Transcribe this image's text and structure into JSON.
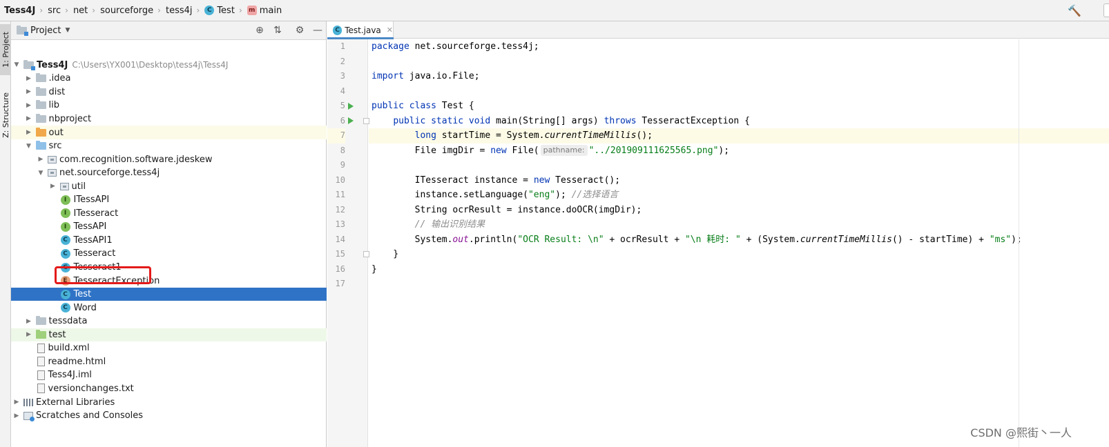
{
  "breadcrumb": [
    {
      "label": "Tess4J",
      "icon": "project-icon"
    },
    {
      "label": "src",
      "icon": "folder-icon"
    },
    {
      "label": "net",
      "icon": "package-icon"
    },
    {
      "label": "sourceforge",
      "icon": "package-icon"
    },
    {
      "label": "tess4j",
      "icon": "package-icon"
    },
    {
      "label": "Test",
      "icon": "class-icon",
      "badge": "C"
    },
    {
      "label": "main",
      "icon": "method-icon",
      "badge": "m"
    }
  ],
  "toolwindow_tabs": {
    "project": "1: Project",
    "structure": "Z: Structure"
  },
  "project_panel": {
    "title": "Project",
    "root": {
      "name": "Tess4J",
      "path": "C:\\Users\\YX001\\Desktop\\tess4j\\Tess4J"
    },
    "items": [
      {
        "label": ".idea",
        "depth": 1,
        "icon": "folder",
        "expanded": false
      },
      {
        "label": "dist",
        "depth": 1,
        "icon": "folder",
        "expanded": false
      },
      {
        "label": "lib",
        "depth": 1,
        "icon": "folder",
        "expanded": false
      },
      {
        "label": "nbproject",
        "depth": 1,
        "icon": "folder",
        "expanded": false
      },
      {
        "label": "out",
        "depth": 1,
        "icon": "folder-orange",
        "expanded": false,
        "highlight": "out"
      },
      {
        "label": "src",
        "depth": 1,
        "icon": "folder-blue",
        "expanded": true
      },
      {
        "label": "com.recognition.software.jdeskew",
        "depth": 2,
        "icon": "package",
        "expanded": false
      },
      {
        "label": "net.sourceforge.tess4j",
        "depth": 2,
        "icon": "package",
        "expanded": true
      },
      {
        "label": "util",
        "depth": 3,
        "icon": "package",
        "expanded": false
      },
      {
        "label": "ITessAPI",
        "depth": 3,
        "icon": "interface",
        "badge": "I"
      },
      {
        "label": "ITesseract",
        "depth": 3,
        "icon": "interface",
        "badge": "I"
      },
      {
        "label": "TessAPI",
        "depth": 3,
        "icon": "interface",
        "badge": "I"
      },
      {
        "label": "TessAPI1",
        "depth": 3,
        "icon": "class",
        "badge": "C"
      },
      {
        "label": "Tesseract",
        "depth": 3,
        "icon": "class",
        "badge": "C"
      },
      {
        "label": "Tesseract1",
        "depth": 3,
        "icon": "class",
        "badge": "C"
      },
      {
        "label": "TesseractException",
        "depth": 3,
        "icon": "exception",
        "badge": "E"
      },
      {
        "label": "Test",
        "depth": 3,
        "icon": "class",
        "badge": "C",
        "selected": true
      },
      {
        "label": "Word",
        "depth": 3,
        "icon": "class",
        "badge": "C"
      },
      {
        "label": "tessdata",
        "depth": 1,
        "icon": "folder",
        "expanded": false
      },
      {
        "label": "test",
        "depth": 1,
        "icon": "folder-green",
        "expanded": false,
        "highlight": "test"
      },
      {
        "label": "build.xml",
        "depth": 1,
        "icon": "file"
      },
      {
        "label": "readme.html",
        "depth": 1,
        "icon": "file"
      },
      {
        "label": "Tess4J.iml",
        "depth": 1,
        "icon": "file"
      },
      {
        "label": "versionchanges.txt",
        "depth": 1,
        "icon": "file"
      },
      {
        "label": "External Libraries",
        "depth": 0,
        "icon": "library",
        "expanded": false
      },
      {
        "label": "Scratches and Consoles",
        "depth": 0,
        "icon": "scratch",
        "expanded": false
      }
    ]
  },
  "editor": {
    "tab": {
      "label": "Test.java",
      "badge": "C"
    },
    "current_line": 7,
    "lines": [
      {
        "n": "1",
        "html": "<span class=\"kw\">package</span> net.sourceforge.tess4j;"
      },
      {
        "n": "2",
        "html": ""
      },
      {
        "n": "3",
        "html": "<span class=\"kw\">import</span> java.io.File;"
      },
      {
        "n": "4",
        "html": ""
      },
      {
        "n": "5",
        "html": "<span class=\"kw\">public class</span> Test {",
        "run": true
      },
      {
        "n": "6",
        "html": "    <span class=\"kw\">public static void</span> main(String[] args) <span class=\"kw\">throws</span> TesseractException {",
        "run": true,
        "fold": true
      },
      {
        "n": "7",
        "html": "        <span class=\"kw\">long</span> startTime = System.<span class=\"ital\">currentTimeMillis</span>();"
      },
      {
        "n": "8",
        "html": "        File imgDir = <span class=\"kw\">new</span> File(<span class=\"hint\">pathname:</span><span class=\"str\">\"../201909111625565.png\"</span>);"
      },
      {
        "n": "9",
        "html": ""
      },
      {
        "n": "10",
        "html": "        ITesseract instance = <span class=\"kw\">new</span> Tesseract();"
      },
      {
        "n": "11",
        "html": "        instance.setLanguage(<span class=\"str\">\"eng\"</span>); <span class=\"cmt\">//选择语言</span>"
      },
      {
        "n": "12",
        "html": "        String ocrResult = instance.doOCR(imgDir);"
      },
      {
        "n": "13",
        "html": "        <span class=\"cmt\">// 输出识别结果</span>"
      },
      {
        "n": "14",
        "html": "        System.<span class=\"fld\">out</span>.println(<span class=\"str\">\"OCR Result: \\n\"</span> + ocrResult + <span class=\"str\">\"\\n 耗时: \"</span> + (System.<span class=\"ital\">currentTimeMillis</span>() - startTime) + <span class=\"str\">\"ms\"</span>);"
      },
      {
        "n": "15",
        "html": "    }",
        "fold": true
      },
      {
        "n": "16",
        "html": "}"
      },
      {
        "n": "17",
        "html": ""
      }
    ]
  },
  "watermark": "CSDN @熙街丶一人"
}
